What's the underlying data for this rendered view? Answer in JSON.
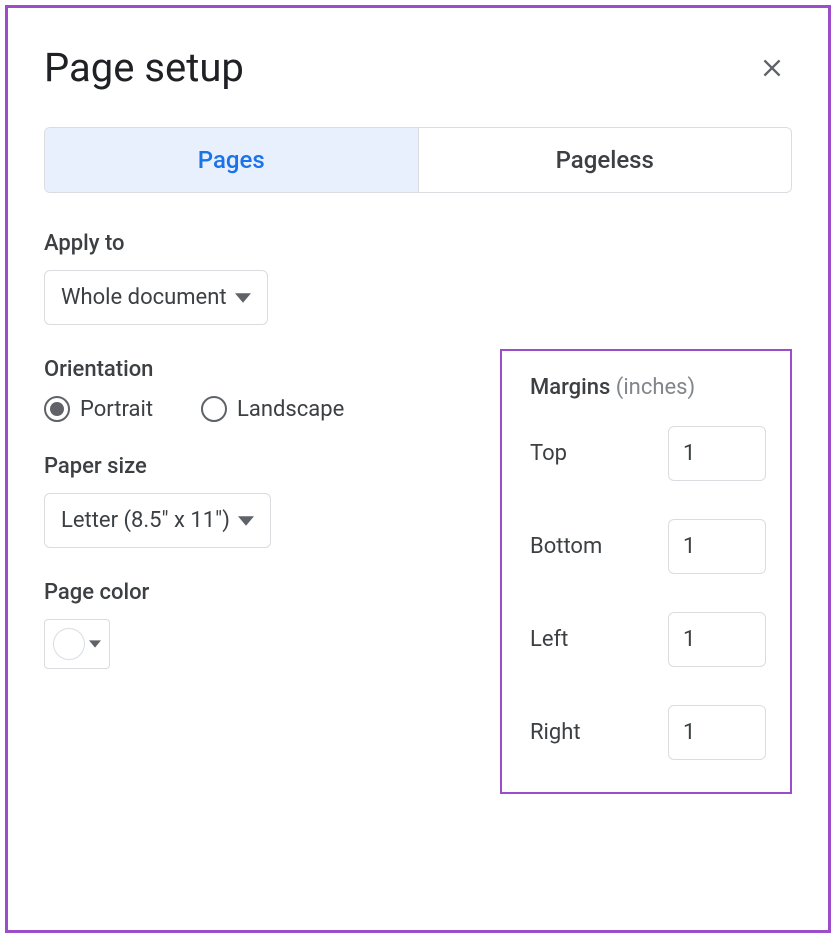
{
  "dialog": {
    "title": "Page setup"
  },
  "tabs": {
    "pages": "Pages",
    "pageless": "Pageless"
  },
  "applyTo": {
    "label": "Apply to",
    "value": "Whole document"
  },
  "orientation": {
    "label": "Orientation",
    "portrait": "Portrait",
    "landscape": "Landscape"
  },
  "paperSize": {
    "label": "Paper size",
    "value": "Letter (8.5\" x 11\")"
  },
  "pageColor": {
    "label": "Page color"
  },
  "margins": {
    "label": "Margins",
    "unit": "(inches)",
    "top": {
      "label": "Top",
      "value": "1"
    },
    "bottom": {
      "label": "Bottom",
      "value": "1"
    },
    "left": {
      "label": "Left",
      "value": "1"
    },
    "right": {
      "label": "Right",
      "value": "1"
    }
  }
}
